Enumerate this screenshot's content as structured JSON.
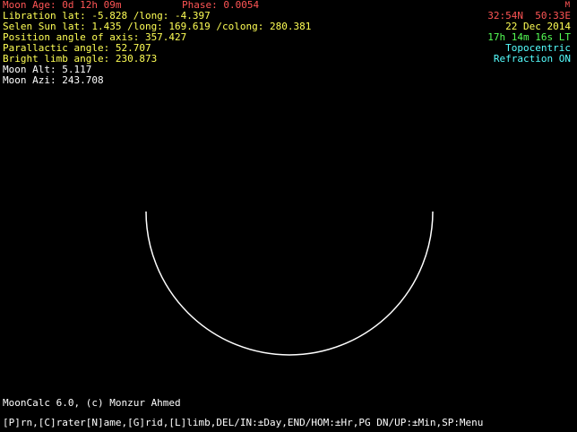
{
  "header": {
    "moon_age": "Moon Age: 0d 12h 09m",
    "phase": "Phase: 0.0054",
    "mode_indicator": "M",
    "libration": "Libration lat: -5.828 /long: -4.397",
    "selen_sun": "Selen Sun lat: 1.435 /long: 169.619 /colong: 280.381",
    "position_angle": "Position angle of axis: 357.427",
    "parallactic_angle": "Parallactic angle: 52.707",
    "bright_limb_angle": "Bright limb angle: 230.873",
    "moon_alt": "Moon Alt: 5.117",
    "moon_azi": "Moon Azi: 243.708"
  },
  "location": {
    "coordinates": "32:54N  50:33E",
    "date": "22 Dec 2014",
    "time": "17h 14m 16s LT",
    "mode": "Topocentric",
    "refraction": "Refraction ON"
  },
  "moon": {
    "phase_fraction": 0.0054,
    "bright_limb_color": "#ffffff"
  },
  "footer": {
    "copyright": "MoonCalc 6.0, (c) Monzur Ahmed",
    "menu": "[P]rn,[C]rater[N]ame,[G]rid,[L]limb,DEL/IN:±Day,END/HOM:±Hr,PG DN/UP:±Min,SP:Menu"
  },
  "colors": {
    "background": "#000000",
    "red": "#ff5555",
    "yellow": "#ffff55",
    "green": "#55ff55",
    "cyan": "#55ffff",
    "white": "#ffffff"
  }
}
